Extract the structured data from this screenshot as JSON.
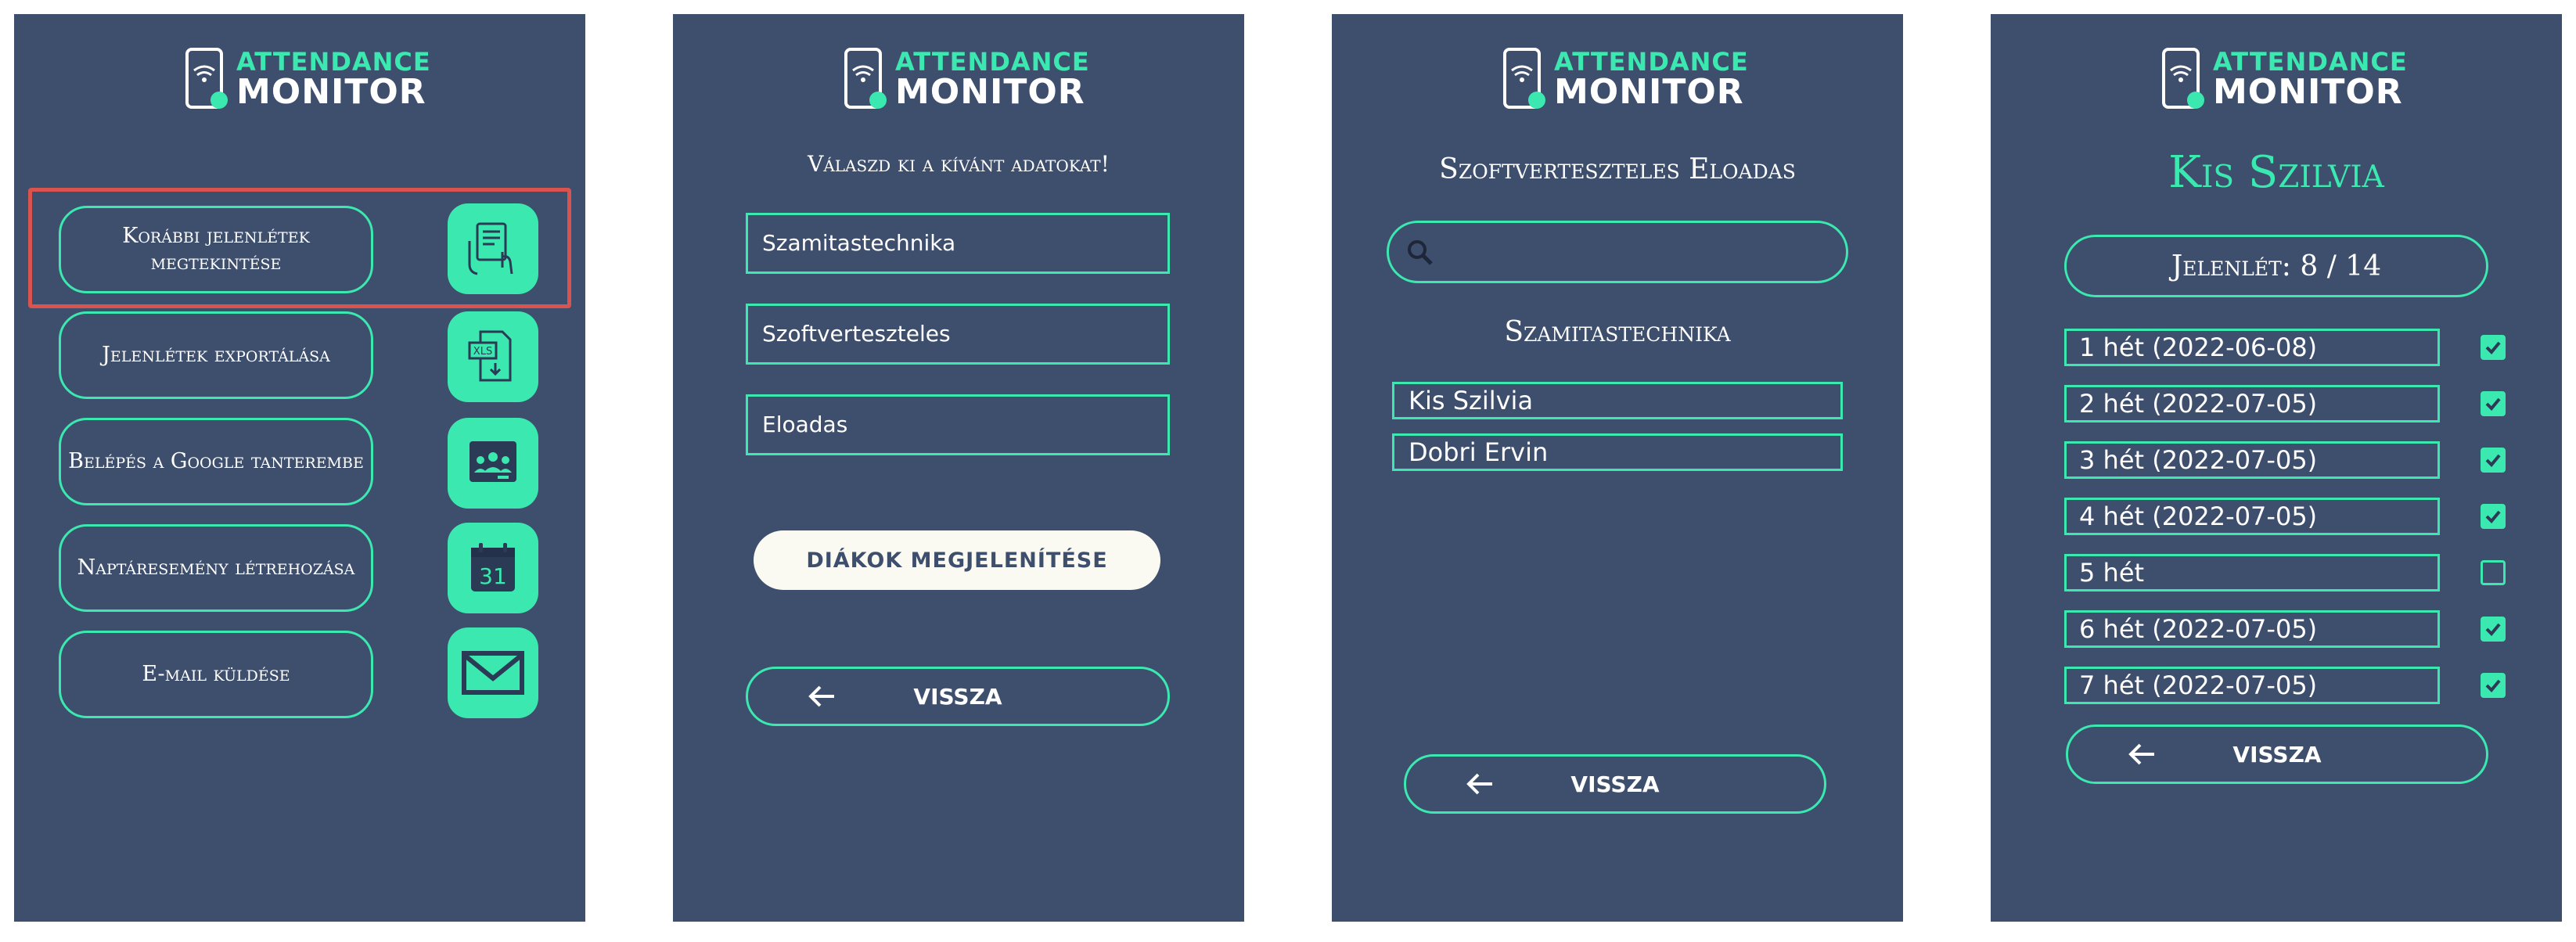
{
  "logo": {
    "line1": "ATTENDANCE",
    "line2": "MONITOR"
  },
  "colors": {
    "background": "#3e4e6d",
    "accent": "#3be8b0",
    "highlight": "#d9534f",
    "button_fill": "#fbfaf2"
  },
  "screen1": {
    "menu": [
      {
        "label": "Korábbi jelenlétek megtekintése",
        "icon": "touch-document-icon",
        "highlighted": true
      },
      {
        "label": "Jelenlétek exportálása",
        "icon": "xls-file-icon",
        "highlighted": false
      },
      {
        "label": "Belépés a Google tanterembe",
        "icon": "google-classroom-icon",
        "highlighted": false
      },
      {
        "label": "Naptáresemény létrehozása",
        "icon": "calendar-icon",
        "highlighted": false
      },
      {
        "label": "E-mail küldése",
        "icon": "envelope-icon",
        "highlighted": false
      }
    ],
    "calendar_icon_day": "31",
    "xls_icon_text": "XLS"
  },
  "screen2": {
    "prompt": "Válaszd ki a kívánt adatokat!",
    "fields": [
      "Szamitastechnika",
      "Szoftverteszteles",
      "Eloadas"
    ],
    "show_students_label": "DIÁKOK MEGJELENÍTÉSE",
    "back_label": "VISSZA"
  },
  "screen3": {
    "title": "Szoftverteszteles Eloadas",
    "search_value": "",
    "group": "Szamitastechnika",
    "students": [
      "Kis Szilvia",
      "Dobri Ervin"
    ],
    "back_label": "VISSZA"
  },
  "screen4": {
    "student_name": "Kis Szilvia",
    "attendance_label": "Jelenlét: 8 / 14",
    "weeks": [
      {
        "label": "1 hét (2022-06-08)",
        "checked": true
      },
      {
        "label": "2 hét (2022-07-05)",
        "checked": true
      },
      {
        "label": "3 hét (2022-07-05)",
        "checked": true
      },
      {
        "label": "4 hét (2022-07-05)",
        "checked": true
      },
      {
        "label": "5 hét",
        "checked": false
      },
      {
        "label": "6 hét (2022-07-05)",
        "checked": true
      },
      {
        "label": "7 hét (2022-07-05)",
        "checked": true
      }
    ],
    "back_label": "VISSZA"
  }
}
